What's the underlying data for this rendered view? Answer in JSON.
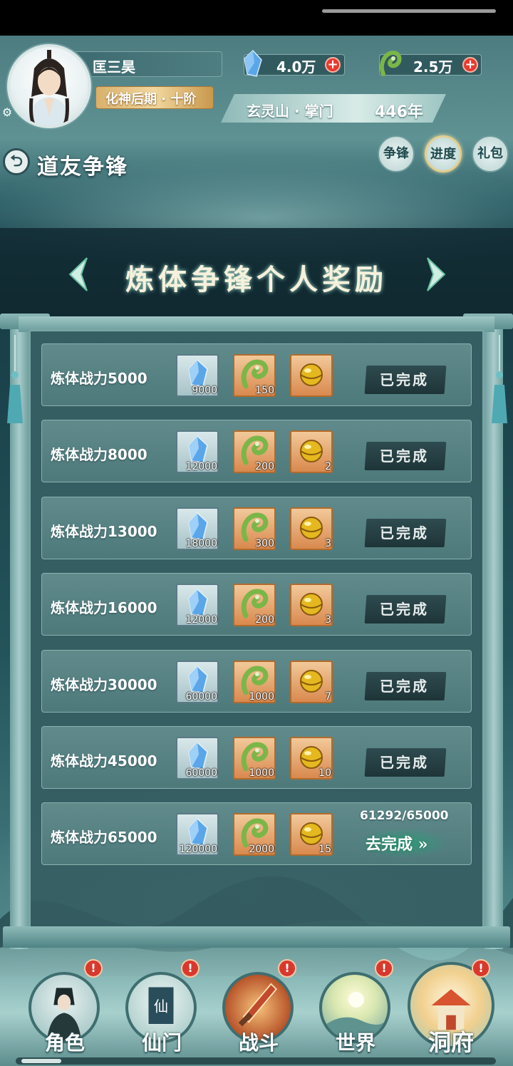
{
  "header": {
    "player_name": "匡三昊",
    "realm": "化神后期 · 十阶",
    "crystal_amount": "4.0万",
    "jade_amount": "2.5万",
    "plus": "+",
    "sect": "玄灵山 · 掌门",
    "years": "446年"
  },
  "page": {
    "back_icon": "⮌",
    "title": "道友争锋",
    "tabs": [
      "争锋",
      "进度",
      "礼包"
    ]
  },
  "banner": {
    "title": "炼体争锋个人奖励"
  },
  "colors": {
    "accent_green": "#1c7c5a",
    "done_btn": "#1e3538",
    "alert_red": "#d8392d"
  },
  "tasks": [
    {
      "label": "炼体战力5000",
      "rewards": [
        "9000",
        "150",
        ""
      ],
      "status": "已完成"
    },
    {
      "label": "炼体战力8000",
      "rewards": [
        "12000",
        "200",
        "2"
      ],
      "status": "已完成"
    },
    {
      "label": "炼体战力13000",
      "rewards": [
        "18000",
        "300",
        "3"
      ],
      "status": "已完成"
    },
    {
      "label": "炼体战力16000",
      "rewards": [
        "12000",
        "200",
        "3"
      ],
      "status": "已完成"
    },
    {
      "label": "炼体战力30000",
      "rewards": [
        "60000",
        "1000",
        "7"
      ],
      "status": "已完成"
    },
    {
      "label": "炼体战力45000",
      "rewards": [
        "60000",
        "1000",
        "10"
      ],
      "status": "已完成"
    },
    {
      "label": "炼体战力65000",
      "rewards": [
        "120000",
        "2000",
        "15"
      ],
      "status": "去完成",
      "progress": "61292/65000",
      "arrow": "»"
    }
  ],
  "reward_icons": [
    "crystal-icon",
    "jade-icon",
    "gold-orb-icon"
  ],
  "nav": {
    "alert": "!",
    "items": [
      {
        "label": "角色",
        "icon": "character-icon"
      },
      {
        "label": "仙门",
        "icon": "sect-banner-icon",
        "glyph": "仙"
      },
      {
        "label": "战斗",
        "icon": "sword-icon"
      },
      {
        "label": "世界",
        "icon": "world-icon"
      },
      {
        "label": "洞府",
        "icon": "cave-palace-icon"
      }
    ]
  }
}
